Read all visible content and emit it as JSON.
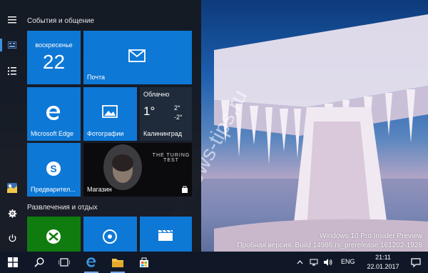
{
  "wallpaper": {
    "watermark_text": "windows-tips.ru",
    "os_name": "Windows 10 Pro Insider Preview",
    "build_line": "Пробная версия. Build 14986.rs_prerelease.161202-1928"
  },
  "start_menu": {
    "rail": {
      "items": [
        {
          "icon": "hamburger-menu-icon"
        },
        {
          "icon": "tiles-view-icon"
        },
        {
          "icon": "all-apps-list-icon"
        },
        {
          "icon": "user-avatar-icon"
        },
        {
          "icon": "settings-gear-icon"
        },
        {
          "icon": "power-icon"
        }
      ]
    },
    "groups": [
      {
        "title": "События и общение"
      },
      {
        "title": "Развлечения и отдых"
      }
    ],
    "tiles": {
      "calendar": {
        "day_name": "воскресенье",
        "day_number": "22"
      },
      "mail": {
        "label": "Почта"
      },
      "edge": {
        "label": "Microsoft Edge"
      },
      "photos": {
        "label": "Фотографии"
      },
      "weather": {
        "condition": "Облачно",
        "temp": "1°",
        "high": "2°",
        "low": "-2°",
        "city": "Калининград"
      },
      "skype": {
        "label": "Предварител..."
      },
      "store": {
        "label": "Магазин",
        "promo_title": "THE TURING TEST"
      },
      "xbox": {
        "label": ""
      },
      "groove": {
        "label": ""
      },
      "movies": {
        "label": ""
      }
    }
  },
  "taskbar": {
    "language": "ENG",
    "time": "21:11",
    "date": "22.01.2017"
  },
  "colors": {
    "tile_blue": "#0e78d6",
    "xbox_green": "#107c10",
    "taskbar": "#101828",
    "accent": "#3d8fe0"
  }
}
